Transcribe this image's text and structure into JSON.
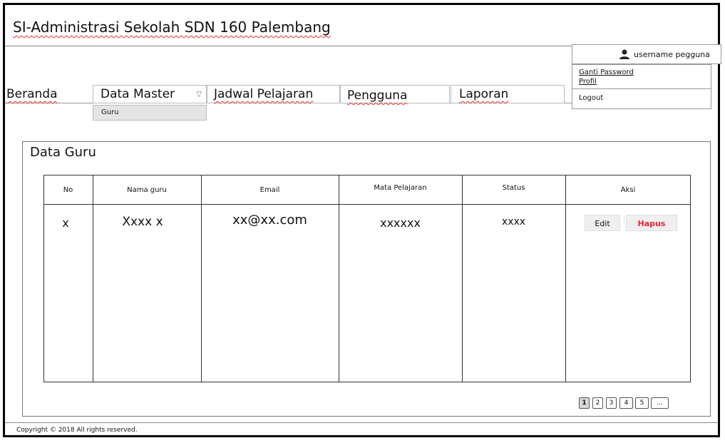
{
  "app": {
    "title": "SI-Administrasi Sekolah SDN 160 Palembang"
  },
  "user": {
    "icon": "user-icon",
    "name": "username pegguna",
    "menu": {
      "change_password": "Ganti Password",
      "profile": "Profil",
      "logout": "Logout"
    }
  },
  "nav": {
    "beranda": "Beranda",
    "data_master": "Data Master",
    "data_master_submenu": [
      "Guru"
    ],
    "jadwal": "Jadwal Pelajaran",
    "pengguna": "Pengguna",
    "laporan": "Laporan"
  },
  "main": {
    "title": "Data Guru",
    "table": {
      "headers": [
        "No",
        "Nama guru",
        "Email",
        "Mata Pelajaran",
        "Status",
        "Aksi"
      ],
      "rows": [
        {
          "no": "x",
          "nama": "Xxxx x",
          "email": "xx@xx.com",
          "mapel": "xxxxxx",
          "status": "xxxx",
          "edit": "Edit",
          "hapus": "Hapus"
        }
      ]
    },
    "pagination": {
      "pages": [
        "1",
        "2",
        "3",
        "4",
        "5",
        "..."
      ],
      "current": "1"
    }
  },
  "footer": {
    "copyright": "Copyright © 2018  All rights reserved."
  },
  "colors": {
    "delete": "#ee2233",
    "spell_underline": "#dd3333"
  }
}
